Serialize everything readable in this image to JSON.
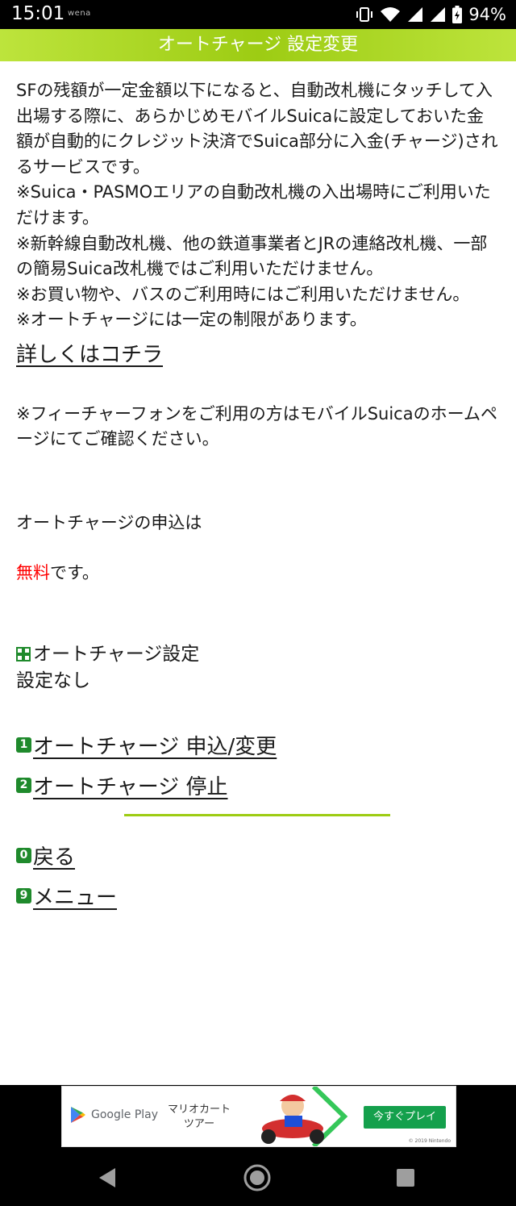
{
  "status": {
    "time": "15:01",
    "tag": "wena",
    "battery": "94%",
    "icons": [
      "vibrate-icon",
      "wifi-icon",
      "signal-icon",
      "signal-icon",
      "battery-icon"
    ]
  },
  "header": {
    "title": "オートチャージ 設定変更"
  },
  "description": "SFの残額が一定金額以下になると、自動改札機にタッチして入出場する際に、あらかじめモバイルSuicaに設定しておいた金額が自動的にクレジット決済でSuica部分に入金(チャージ)されるサービスです。\n※Suica・PASMOエリアの自動改札機の入出場時にご利用いただけます。\n※新幹線自動改札機、他の鉄道事業者とJRの連絡改札機、一部の簡易Suica改札機ではご利用いただけません。\n※お買い物や、バスのご利用時にはご利用いただけません。\n※オートチャージには一定の制限があります。",
  "detail_link": "詳しくはコチラ",
  "feature_phone_note": "※フィーチャーフォンをご利用の方はモバイルSuicaのホームページにてご確認ください。",
  "apply": {
    "line1": "オートチャージの申込は",
    "free": "無料",
    "suffix": "です。"
  },
  "setting": {
    "label": "オートチャージ設定",
    "value": "設定なし"
  },
  "menu": [
    {
      "key": "1",
      "label": "オートチャージ 申込/変更"
    },
    {
      "key": "2",
      "label": "オートチャージ 停止"
    }
  ],
  "nav": [
    {
      "key": "0",
      "label": "戻る"
    },
    {
      "key": "9",
      "label": "メニュー"
    }
  ],
  "ad": {
    "store": "Google Play",
    "game": "マリオカート\nツアー",
    "cta": "今すぐプレイ",
    "copyright": "© 2019 Nintendo"
  },
  "colors": {
    "header_green": "#9dcc13",
    "key_green": "#1f8a2c",
    "free_red": "#ff0000",
    "cta_green": "#14a04c"
  }
}
